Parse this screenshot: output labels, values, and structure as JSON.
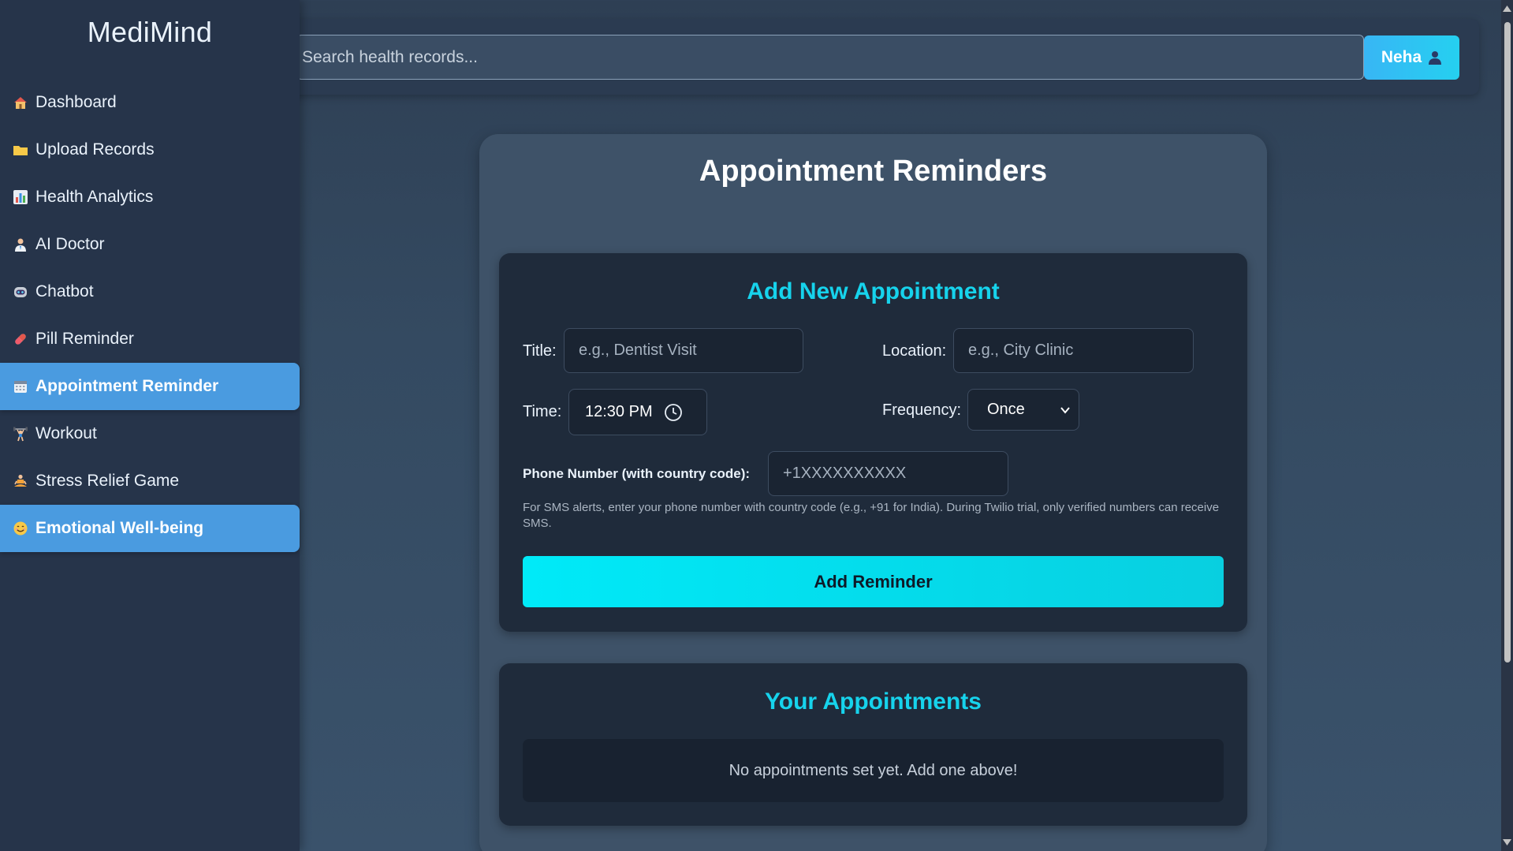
{
  "brand": "MediMind",
  "sidebar": {
    "items": [
      {
        "label": "Dashboard",
        "icon": "house-icon",
        "active": false
      },
      {
        "label": "Upload Records",
        "icon": "folder-icon",
        "active": false
      },
      {
        "label": "Health Analytics",
        "icon": "bar-chart-icon",
        "active": false
      },
      {
        "label": "AI Doctor",
        "icon": "doctor-icon",
        "active": false
      },
      {
        "label": "Chatbot",
        "icon": "robot-icon",
        "active": false
      },
      {
        "label": "Pill Reminder",
        "icon": "pill-icon",
        "active": false
      },
      {
        "label": "Appointment Reminder",
        "icon": "calendar-icon",
        "active": true
      },
      {
        "label": "Workout",
        "icon": "weightlifter-icon",
        "active": false
      },
      {
        "label": "Stress Relief Game",
        "icon": "meditation-icon",
        "active": false
      },
      {
        "label": "Emotional Well-being",
        "icon": "smiley-icon",
        "active": true
      }
    ]
  },
  "header": {
    "search_placeholder": "Search health records...",
    "user_name": "Neha"
  },
  "main": {
    "title": "Appointment Reminders",
    "add_form": {
      "heading": "Add New Appointment",
      "title_label": "Title:",
      "title_placeholder": "e.g., Dentist Visit",
      "location_label": "Location:",
      "location_placeholder": "e.g., City Clinic",
      "time_label": "Time:",
      "time_value": "12:30 PM",
      "frequency_label": "Frequency:",
      "frequency_value": "Once",
      "phone_label": "Phone Number (with country code):",
      "phone_placeholder": "+1XXXXXXXXXX",
      "hint": "For SMS alerts, enter your phone number with country code (e.g., +91 for India). During Twilio trial, only verified numbers can receive SMS.",
      "submit_label": "Add Reminder"
    },
    "list": {
      "heading": "Your Appointments",
      "empty_text": "No appointments set yet. Add one above!"
    }
  },
  "colors": {
    "accent": "#16d3ec",
    "active_nav": "#4a9be0",
    "button_gradient_start": "#00eaf8"
  }
}
